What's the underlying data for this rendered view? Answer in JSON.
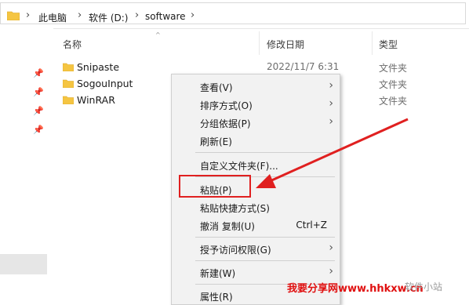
{
  "breadcrumb": {
    "items": [
      "此电脑",
      "软件 (D:)",
      "software"
    ],
    "separator": "›"
  },
  "columns": {
    "name": "名称",
    "date": "修改日期",
    "type": "类型"
  },
  "files": [
    {
      "name": "Snipaste",
      "date": "2022/11/7 6:31",
      "type": "文件夹"
    },
    {
      "name": "SogouInput",
      "date": "",
      "type": "文件夹"
    },
    {
      "name": "WinRAR",
      "date": "",
      "type": "文件夹"
    }
  ],
  "menu": {
    "view": "查看(V)",
    "sort": "排序方式(O)",
    "group": "分组依据(P)",
    "refresh": "刷新(E)",
    "customize": "自定义文件夹(F)...",
    "paste": "粘贴(P)",
    "paste_shortcut": "粘贴快捷方式(S)",
    "undo": "撤消 复制(U)",
    "undo_shortcut": "Ctrl+Z",
    "access": "授予访问权限(G)",
    "new": "新建(W)",
    "properties": "属性(R)"
  },
  "watermark": {
    "text": "我要分享网www.hhkxw.cn",
    "faint": "软件小站"
  },
  "colors": {
    "folder": "#f5c542",
    "highlight": "#e02020",
    "arrow": "#e02020"
  }
}
